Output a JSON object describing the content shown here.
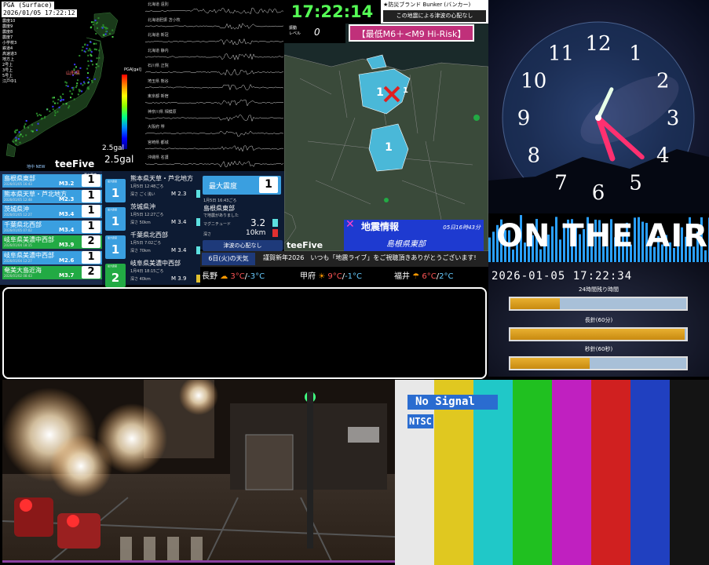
{
  "pga": {
    "title": "PGA (Surface)",
    "datetime": "2026/01/05 17:22:12",
    "stats": [
      "震度10",
      "震度9",
      "震度8",
      "震度7",
      "小学校3",
      "鉄道4",
      "高速道3",
      "地方上",
      "2号上",
      "3号上",
      "5号上",
      "江戸中1"
    ],
    "scale_label": "PGA[gal]",
    "region_label": "山形県",
    "gal_small": "2.5gal",
    "gal_big": "2.5gal",
    "brand": "teeFive",
    "new_label": "地中 NEW"
  },
  "seismo": {
    "labels": [
      "北海道 遠別",
      "北海道胆振 苫小牧",
      "北海道 新冠",
      "北海道 静内",
      "石川県 正院",
      "埼玉県 熊谷",
      "東京都 新宿",
      "神奈川県 相模原",
      "大阪府 堺",
      "宮崎県 都城",
      "沖縄県 名護"
    ]
  },
  "quake_list": {
    "header": "最大震度",
    "items": [
      {
        "place": "島根県東部",
        "time": "2026/01/05 16:43",
        "mag": "M3.2",
        "intensity": "1",
        "color": "#3a9fe0"
      },
      {
        "place": "熊本県天草・芦北地方",
        "time": "2026/01/05 12:48",
        "mag": "M2.3",
        "intensity": "1",
        "color": "#3a9fe0"
      },
      {
        "place": "茨城県沖",
        "time": "2026/01/05 12:27",
        "mag": "M3.4",
        "intensity": "1",
        "color": "#3a9fe0"
      },
      {
        "place": "千葉県北西部",
        "time": "2026/01/05 07:02",
        "mag": "M3.4",
        "intensity": "1",
        "color": "#3a9fe0"
      },
      {
        "place": "岐阜県美濃中西部",
        "time": "2026/01/04 18:15",
        "mag": "M3.9",
        "intensity": "2",
        "color": "#22aa44"
      },
      {
        "place": "岐阜県美濃中西部",
        "time": "2026/01/04 12:27",
        "mag": "M2.6",
        "intensity": "1",
        "color": "#3a9fe0"
      },
      {
        "place": "奄美大島近海",
        "time": "2026/01/02 08:43",
        "mag": "M3.7",
        "intensity": "2",
        "color": "#22aa44"
      }
    ]
  },
  "quake_detail": {
    "badge_label": "最大震度",
    "items": [
      {
        "place": "熊本県天草・芦北地方",
        "time": "1月5日 12:48ごろ",
        "depth": "深さ ごく浅い",
        "mag": "M 2.3",
        "intensity": "1",
        "bar_color": "#5ce0e0"
      },
      {
        "place": "茨城県沖",
        "time": "1月5日 12:27ごろ",
        "depth": "深さ 50km",
        "mag": "M 3.4",
        "intensity": "1",
        "bar_color": "#5ce0e0"
      },
      {
        "place": "千葉県北西部",
        "time": "1月5日 7:02ごろ",
        "depth": "深さ 70km",
        "mag": "M 3.4",
        "intensity": "1",
        "bar_color": "#5ce0e0"
      },
      {
        "place": "岐阜県美濃中西部",
        "time": "1月4日 18:15ごろ",
        "depth": "深さ 40km",
        "mag": "M 3.9",
        "intensity": "2",
        "bar_color": "#e0c030"
      }
    ]
  },
  "max_intensity": {
    "label": "最大震度",
    "value": "1",
    "time": "1月5日 16:43ごろ",
    "place": "島根県東部",
    "note": "で地震がありました",
    "mag_label": "マグニチュード",
    "magnitude": "3.2",
    "depth_label": "深さ",
    "depth": "10km",
    "tsunami": "津波の心配なし"
  },
  "header": {
    "clock": "17:22:14",
    "bunker_title": "★防災ブランド Bunker (バンカー)",
    "bunker_msg": "この地震による津波の心配なし"
  },
  "map": {
    "shindo_label_1": "振動",
    "shindo_label_2": "レベル",
    "shindo_value": "0",
    "hirisk": "【最低M6＋<M9 Hi-Risk】",
    "eq_title": "地震情報",
    "eq_date": "05日16時43分",
    "eq_place": "島根県東部",
    "brand": "teeFive",
    "markers": [
      "1",
      "1",
      "1"
    ]
  },
  "ticker": {
    "label": "6日(火)の天気",
    "text": "謹賀新年2026　いつも「地震ライブ」をご視聴頂きありがとうございます!"
  },
  "weather": [
    {
      "city": "長野",
      "icon": "☁",
      "high": "3°C",
      "low": "-3°C"
    },
    {
      "city": "甲府",
      "icon": "☀",
      "high": "9°C",
      "low": "-1°C"
    },
    {
      "city": "福井",
      "icon": "☂",
      "high": "6°C",
      "low": "2°C"
    }
  ],
  "analog_clock": {
    "numbers": [
      "12",
      "1",
      "2",
      "3",
      "4",
      "5",
      "6",
      "7",
      "8",
      "9",
      "10",
      "11"
    ],
    "hour": 5,
    "minute": 22,
    "second": 34
  },
  "on_air": "ON THE AIR",
  "progress": {
    "datetime": "2026-01-05 17:22:34",
    "bars": [
      {
        "label": "24時間残り時間",
        "fill": 0.28
      },
      {
        "label": "長針(60分)",
        "fill": 0.99
      },
      {
        "label": "秒針(60秒)",
        "fill": 0.45
      }
    ]
  },
  "test_pattern": {
    "no_signal": "No Signal",
    "format": "NTSC",
    "colors": [
      "#e8e8e8",
      "#e0c820",
      "#20c8c8",
      "#20c020",
      "#c020c0",
      "#d02020",
      "#2040c0",
      "#141414"
    ]
  }
}
